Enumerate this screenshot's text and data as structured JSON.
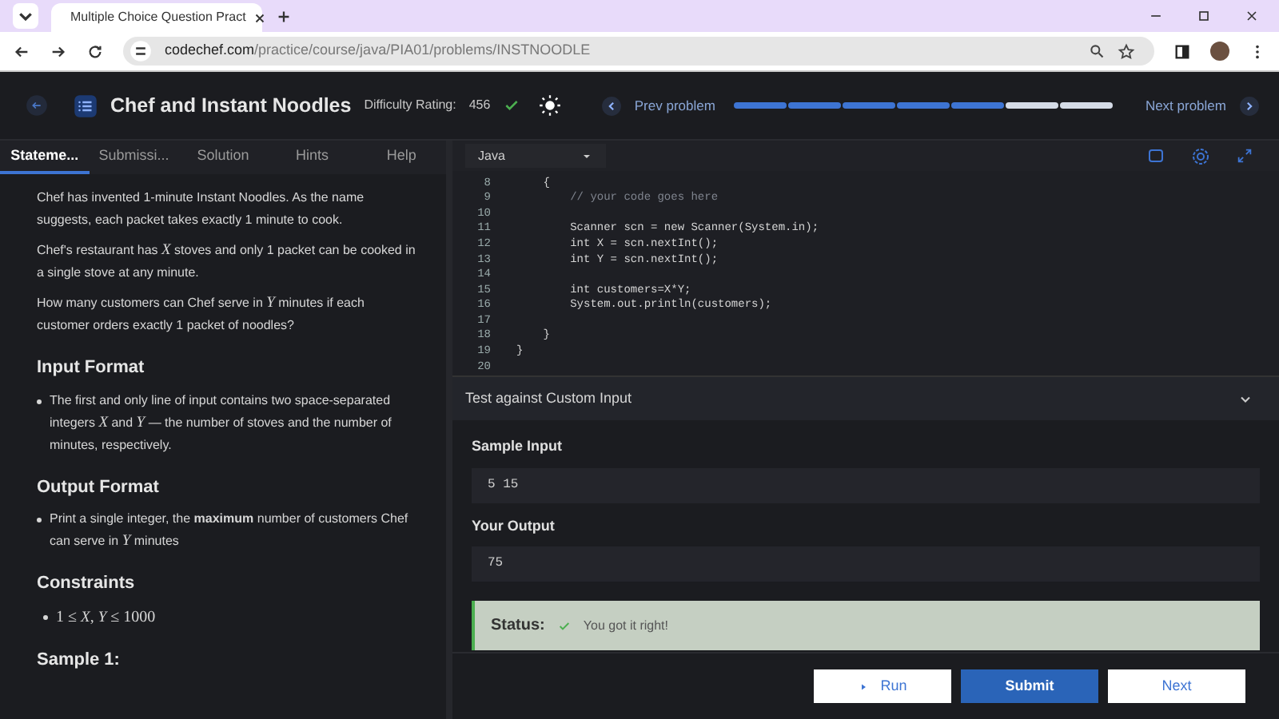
{
  "browser": {
    "tab_title": "Multiple Choice Question Pract",
    "url_host": "codechef.com",
    "url_path": "/practice/course/java/PIA01/problems/INSTNOODLE"
  },
  "header": {
    "title": "Chef and Instant Noodles",
    "difficulty_label": "Difficulty Rating:",
    "difficulty_value": "456",
    "solved": true,
    "prev_label": "Prev problem",
    "next_label": "Next problem",
    "progress": [
      {
        "done": true
      },
      {
        "done": true
      },
      {
        "done": true
      },
      {
        "done": true
      },
      {
        "done": true
      },
      {
        "done": false
      },
      {
        "done": false
      }
    ]
  },
  "tabs": [
    {
      "label": "Stateme...",
      "selected": true
    },
    {
      "label": "Submissi...",
      "selected": false
    },
    {
      "label": "Solution",
      "selected": false
    },
    {
      "label": "Hints",
      "selected": false
    },
    {
      "label": "Help",
      "selected": false
    }
  ],
  "statement": [
    {
      "kind": "paragraph",
      "text": "Chef has invented 1-minute Instant Noodles. As the name suggests, each packet takes exactly 1 minute to cook."
    },
    {
      "kind": "paragraph",
      "text": "Chef's restaurant has *X* stoves and only 1 packet can be cooked in a single stove at any minute."
    },
    {
      "kind": "paragraph",
      "text": "How many customers can Chef serve in *Y* minutes if each customer orders exactly 1 packet of noodles?"
    },
    {
      "kind": "heading",
      "text": "Input Format"
    },
    {
      "kind": "bullet",
      "text": "The first and only line of input contains two space-separated integers *X* and *Y* — the number of stoves and the number of minutes, respectively."
    },
    {
      "kind": "heading",
      "text": "Output Format"
    },
    {
      "kind": "bullet",
      "text": "Print a single integer, the **maximum** number of customers Chef can serve in *Y* minutes"
    },
    {
      "kind": "heading",
      "text": "Constraints"
    },
    {
      "kind": "math",
      "text": "1 ≤ *X*, *Y* ≤ 1000"
    },
    {
      "kind": "heading",
      "text": "Sample 1:"
    }
  ],
  "editor": {
    "language": "Java",
    "lines": [
      {
        "number": "8",
        "text": "    {",
        "kind": "code"
      },
      {
        "number": "9",
        "text": "        // your code goes here",
        "kind": "comment"
      },
      {
        "number": "10"
      },
      {
        "number": "11",
        "text": "        Scanner scn = new Scanner(System.in);",
        "kind": "code"
      },
      {
        "number": "12",
        "text": "        int X = scn.nextInt();",
        "kind": "code"
      },
      {
        "number": "13",
        "text": "        int Y = scn.nextInt();",
        "kind": "code"
      },
      {
        "number": "14"
      },
      {
        "number": "15",
        "text": "        int customers=X*Y;",
        "kind": "code"
      },
      {
        "number": "16",
        "text": "        System.out.println(customers);",
        "kind": "code"
      },
      {
        "number": "17"
      },
      {
        "number": "18",
        "text": "    }",
        "kind": "code"
      },
      {
        "number": "19",
        "text": "}",
        "kind": "code"
      },
      {
        "number": "20"
      }
    ]
  },
  "custom_input": {
    "title": "Test against Custom Input",
    "expanded": true,
    "input_label": "Sample Input",
    "input_value": "5 15",
    "output_label": "Your Output",
    "output_value": "75",
    "status_label": "Status:",
    "status_ok": true,
    "status_text": "You got it right!"
  },
  "buttons": {
    "run": "Run",
    "submit": "Submit",
    "next": "Next"
  }
}
